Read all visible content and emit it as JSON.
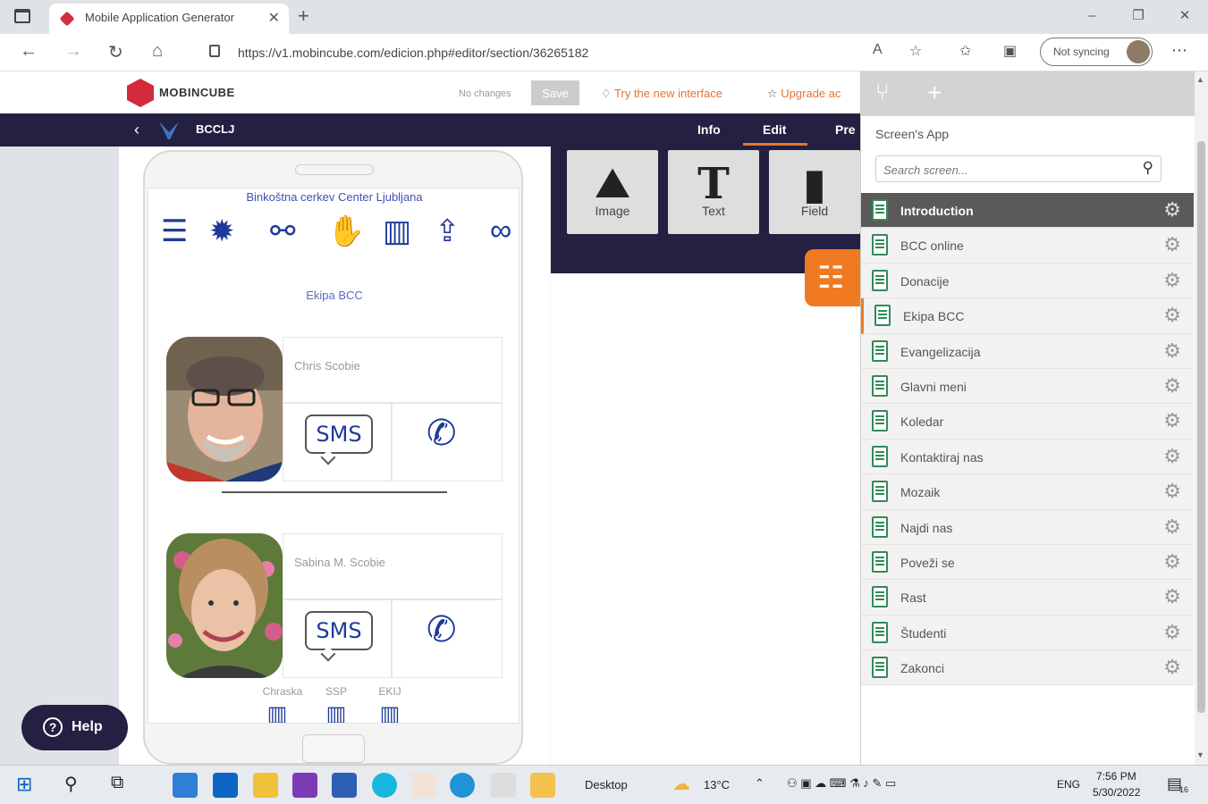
{
  "browser": {
    "tab_title": "Mobile Application Generator",
    "url": "https://v1.mobincube.com/edicion.php#editor/section/36265182",
    "sync_label": "Not syncing",
    "tab_close": "✕",
    "new_tab": "+",
    "controls": [
      "–",
      "❐",
      "✕"
    ]
  },
  "app": {
    "logo_text": "MOBINCUBE",
    "status": "No changes",
    "save_label": "Save",
    "try_new": "Try the new interface",
    "upgrade": "Upgrade ac",
    "app_name": "BCCLJ",
    "tabs": [
      "Info",
      "Edit",
      "Pre"
    ]
  },
  "phone_screen": {
    "church_title": "Binkoštna cerkev Center Ljubljana",
    "section_title": "Ekipa BCC",
    "members": [
      {
        "name": "Chris Scobie",
        "sms": "SMS"
      },
      {
        "name": "Sabina M. Scobie",
        "sms": "SMS"
      }
    ],
    "bottom_labels": [
      "Chraska",
      "SSP",
      "EKIJ"
    ]
  },
  "components": [
    {
      "label": "Image",
      "icon": "image-icon"
    },
    {
      "label": "Text",
      "icon": "text-icon"
    },
    {
      "label": "Field",
      "icon": "field-icon"
    }
  ],
  "help": {
    "label": "Help"
  },
  "screens_panel": {
    "title": "Screen's App",
    "search_placeholder": "Search screen...",
    "items": [
      "Introduction",
      "BCC online",
      "Donacije",
      "Ekipa BCC",
      "Evangelizacija",
      "Glavni meni",
      "Koledar",
      "Kontaktiraj nas",
      "Mozaik",
      "Najdi nas",
      "Poveži se",
      "Rast",
      "Študenti",
      "Zakonci"
    ],
    "active_index": 0,
    "current_index": 3
  },
  "taskbar": {
    "desktop_label": "Desktop",
    "temperature": "13°C",
    "language": "ENG",
    "time": "7:56 PM",
    "date": "5/30/2022",
    "notifications": "16"
  },
  "colors": {
    "accent": "#f07a22",
    "nav_bg": "#232042",
    "icon_blue": "#1e3a9a",
    "brand_red": "#d32a3d"
  }
}
